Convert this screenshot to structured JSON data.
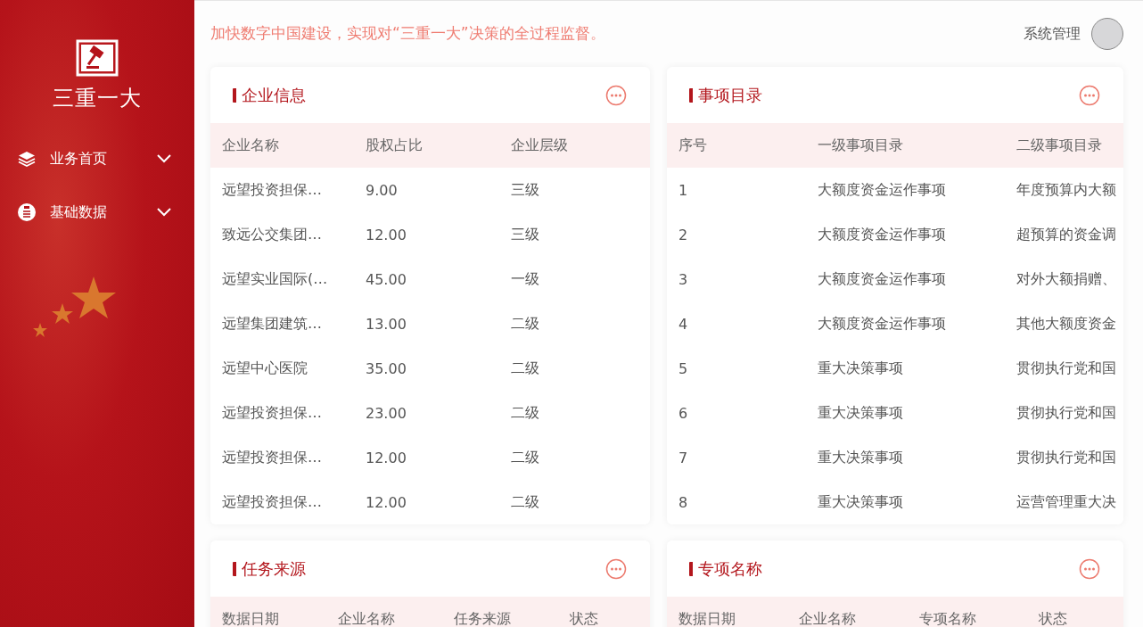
{
  "sidebar": {
    "logo_title": "三重一大",
    "menu": [
      {
        "label": "业务首页",
        "kind": "layers",
        "expanded": false
      },
      {
        "label": "基础数据",
        "kind": "doc",
        "expanded": false
      }
    ]
  },
  "header": {
    "slogan": "加快数字中国建设，实现对“三重一大”决策的全过程监督。",
    "user_name": "系统管理"
  },
  "panels": [
    {
      "title": "企业信息",
      "columns": [
        "企业名称",
        "股权占比",
        "企业层级"
      ],
      "rows": [
        [
          "远望投资担保…",
          "9.00",
          "三级"
        ],
        [
          "致远公交集团…",
          "12.00",
          "三级"
        ],
        [
          "远望实业国际(…",
          "45.00",
          "一级"
        ],
        [
          "远望集团建筑…",
          "13.00",
          "二级"
        ],
        [
          "远望中心医院",
          "35.00",
          "二级"
        ],
        [
          "远望投资担保…",
          "23.00",
          "二级"
        ],
        [
          "远望投资担保…",
          "12.00",
          "二级"
        ],
        [
          "远望投资担保…",
          "12.00",
          "二级"
        ]
      ]
    },
    {
      "title": "事项目录",
      "columns": [
        "序号",
        "一级事项目录",
        "二级事项目录"
      ],
      "rows": [
        [
          "1",
          "大额度资金运作事项",
          "年度预算内大额"
        ],
        [
          "2",
          "大额度资金运作事项",
          "超预算的资金调"
        ],
        [
          "3",
          "大额度资金运作事项",
          "对外大额捐赠、"
        ],
        [
          "4",
          "大额度资金运作事项",
          "其他大额度资金"
        ],
        [
          "5",
          "重大决策事项",
          "贯彻执行党和国"
        ],
        [
          "6",
          "重大决策事项",
          "贯彻执行党和国"
        ],
        [
          "7",
          "重大决策事项",
          "贯彻执行党和国"
        ],
        [
          "8",
          "重大决策事项",
          "运营管理重大决"
        ]
      ]
    },
    {
      "title": "任务来源",
      "columns": [
        "数据日期",
        "企业名称",
        "任务来源",
        "状态"
      ]
    },
    {
      "title": "专项名称",
      "columns": [
        "数据日期",
        "企业名称",
        "专项名称",
        "状态"
      ]
    }
  ]
}
